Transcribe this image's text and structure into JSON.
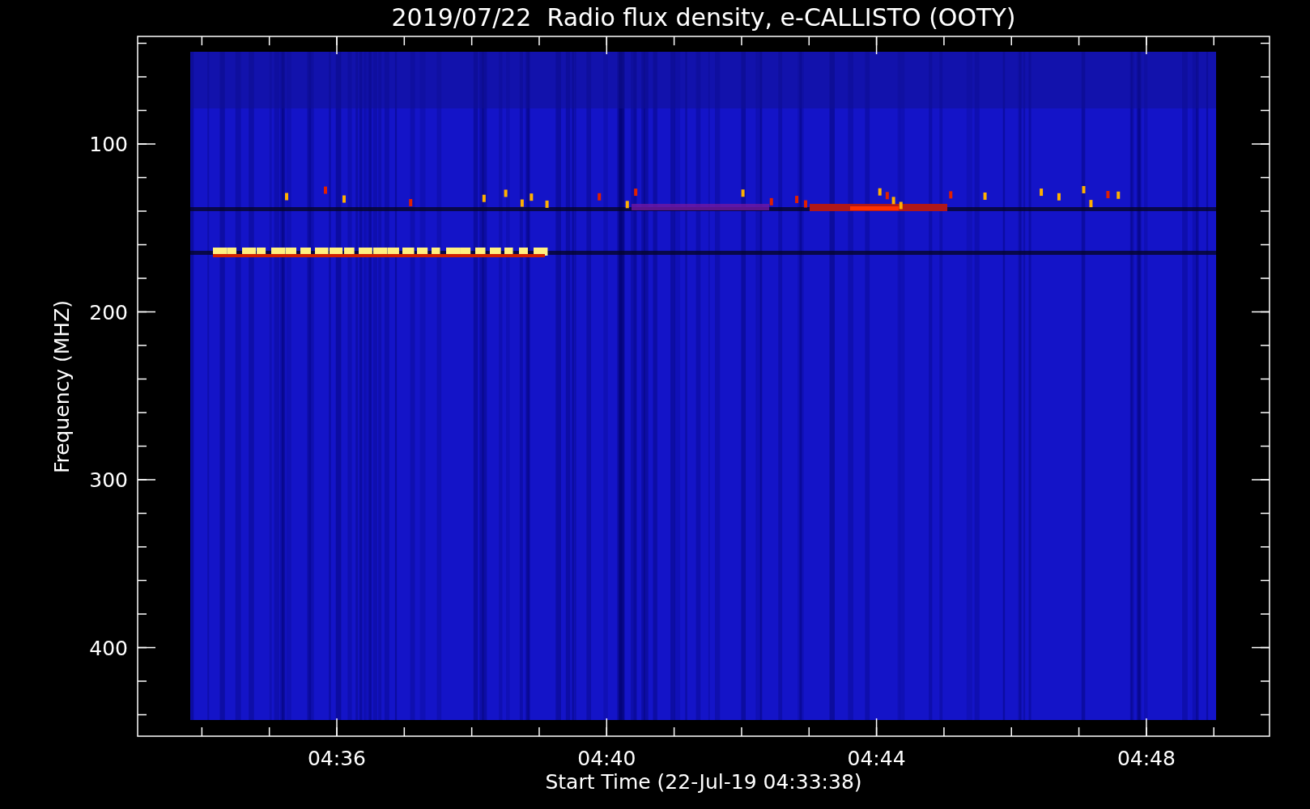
{
  "chart": {
    "title": "2019/07/22  Radio flux density, e-CALLISTO (OOTY)",
    "ylabel": "Frequency (MHZ)",
    "xlabel": "Start Time (22-Jul-19 04:33:38)",
    "yticks": [
      "100",
      "200",
      "300",
      "400"
    ],
    "xticks": [
      "04:36",
      "04:40",
      "04:44",
      "04:48"
    ]
  }
}
